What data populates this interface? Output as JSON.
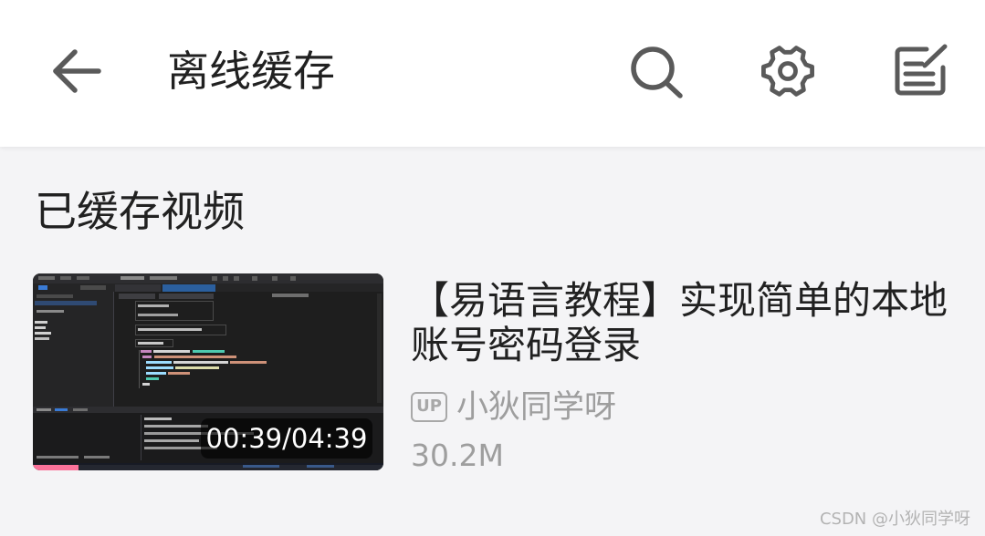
{
  "header": {
    "title": "离线缓存",
    "back_icon": "arrow-back-icon",
    "search_icon": "search-icon",
    "settings_icon": "gear-icon",
    "edit_icon": "edit-note-icon"
  },
  "section": {
    "title": "已缓存视频"
  },
  "videos": [
    {
      "title": "【易语言教程】实现简单的本地账号密码登录",
      "uploader_badge": "UP",
      "uploader": "小狄同学呀",
      "size": "30.2M",
      "duration": "00:39/04:39",
      "progress": 0.13
    }
  ],
  "colors": {
    "accent": "#fb7299",
    "icon": "#5a5a5a",
    "text_primary": "#212121",
    "text_secondary": "#9e9e9e",
    "background": "#f4f4f6",
    "app_bar": "#ffffff"
  },
  "watermark": "CSDN @小狄同学呀"
}
